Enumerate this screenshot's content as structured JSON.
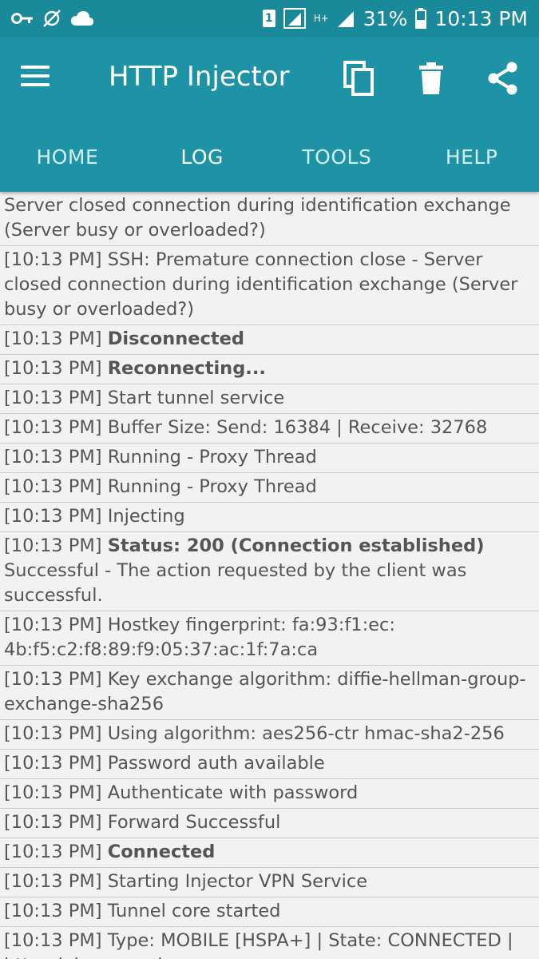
{
  "status_bar": {
    "left_icons": [
      "key-icon",
      "sync-disabled-icon",
      "cloud-icon"
    ],
    "right_icons": [
      "sim-icon",
      "signal-sim1-icon",
      "hspa-icon",
      "signal-sim2-icon",
      "battery-icon"
    ],
    "sim_number": "1",
    "network_type": "H+",
    "battery_percent": "31%",
    "time": "10:13 PM"
  },
  "toolbar": {
    "title": "HTTP Injector",
    "menu_icon": "menu-icon",
    "copy_icon": "copy-icon",
    "delete_icon": "delete-icon",
    "share_icon": "share-icon"
  },
  "tabs": [
    {
      "label": "HOME",
      "active": false
    },
    {
      "label": "LOG",
      "active": true
    },
    {
      "label": "TOOLS",
      "active": false
    },
    {
      "label": "HELP",
      "active": false
    }
  ],
  "colors": {
    "status_bar": "#1a8a9a",
    "app_bar": "#1e93a5",
    "log_background": "#f2f2f2",
    "divider": "#cfcfcf",
    "log_text": "#555555"
  },
  "log_entries": [
    {
      "ts": "",
      "bold": "",
      "text": "Server closed connection during identification exchange (Server busy or overloaded?)"
    },
    {
      "ts": "[10:13 PM] ",
      "bold": "",
      "text": "SSH: Premature connection close - Server closed connection during identification exchange (Server busy or overloaded?)"
    },
    {
      "ts": "[10:13 PM] ",
      "bold": "Disconnected",
      "text": ""
    },
    {
      "ts": "[10:13 PM] ",
      "bold": "Reconnecting...",
      "text": ""
    },
    {
      "ts": "[10:13 PM] ",
      "bold": "",
      "text": "Start tunnel service"
    },
    {
      "ts": "[10:13 PM] ",
      "bold": "",
      "text": "Buffer Size: Send: 16384 | Receive: 32768"
    },
    {
      "ts": "[10:13 PM] ",
      "bold": "",
      "text": "Running - Proxy Thread"
    },
    {
      "ts": "[10:13 PM] ",
      "bold": "",
      "text": "Running - Proxy Thread"
    },
    {
      "ts": "[10:13 PM] ",
      "bold": "",
      "text": "Injecting"
    },
    {
      "ts": "[10:13 PM] ",
      "bold": "Status: 200 (Connection established)",
      "text": " Successful - The action requested by the client was successful."
    },
    {
      "ts": "[10:13 PM] ",
      "bold": "",
      "text": "Hostkey fingerprint: fa:93:f1:ec:\n4b:f5:c2:f8:89:f9:05:37:ac:1f:7a:ca"
    },
    {
      "ts": "[10:13 PM] ",
      "bold": "",
      "text": "Key exchange algorithm: diffie-hellman-group-exchange-sha256"
    },
    {
      "ts": "[10:13 PM] ",
      "bold": "",
      "text": "Using algorithm: aes256-ctr hmac-sha2-256"
    },
    {
      "ts": "[10:13 PM] ",
      "bold": "",
      "text": "Password auth available"
    },
    {
      "ts": "[10:13 PM] ",
      "bold": "",
      "text": "Authenticate with password"
    },
    {
      "ts": "[10:13 PM] ",
      "bold": "",
      "text": "Forward Successful"
    },
    {
      "ts": "[10:13 PM] ",
      "bold": "Connected",
      "text": ""
    },
    {
      "ts": "[10:13 PM] ",
      "bold": "",
      "text": "Starting Injector VPN Service"
    },
    {
      "ts": "[10:13 PM] ",
      "bold": "",
      "text": "Tunnel core started"
    },
    {
      "ts": "[10:13 PM] ",
      "bold": "",
      "text": "Type: MOBILE [HSPA+] | State: CONNECTED | http.globe.com.ph"
    }
  ]
}
